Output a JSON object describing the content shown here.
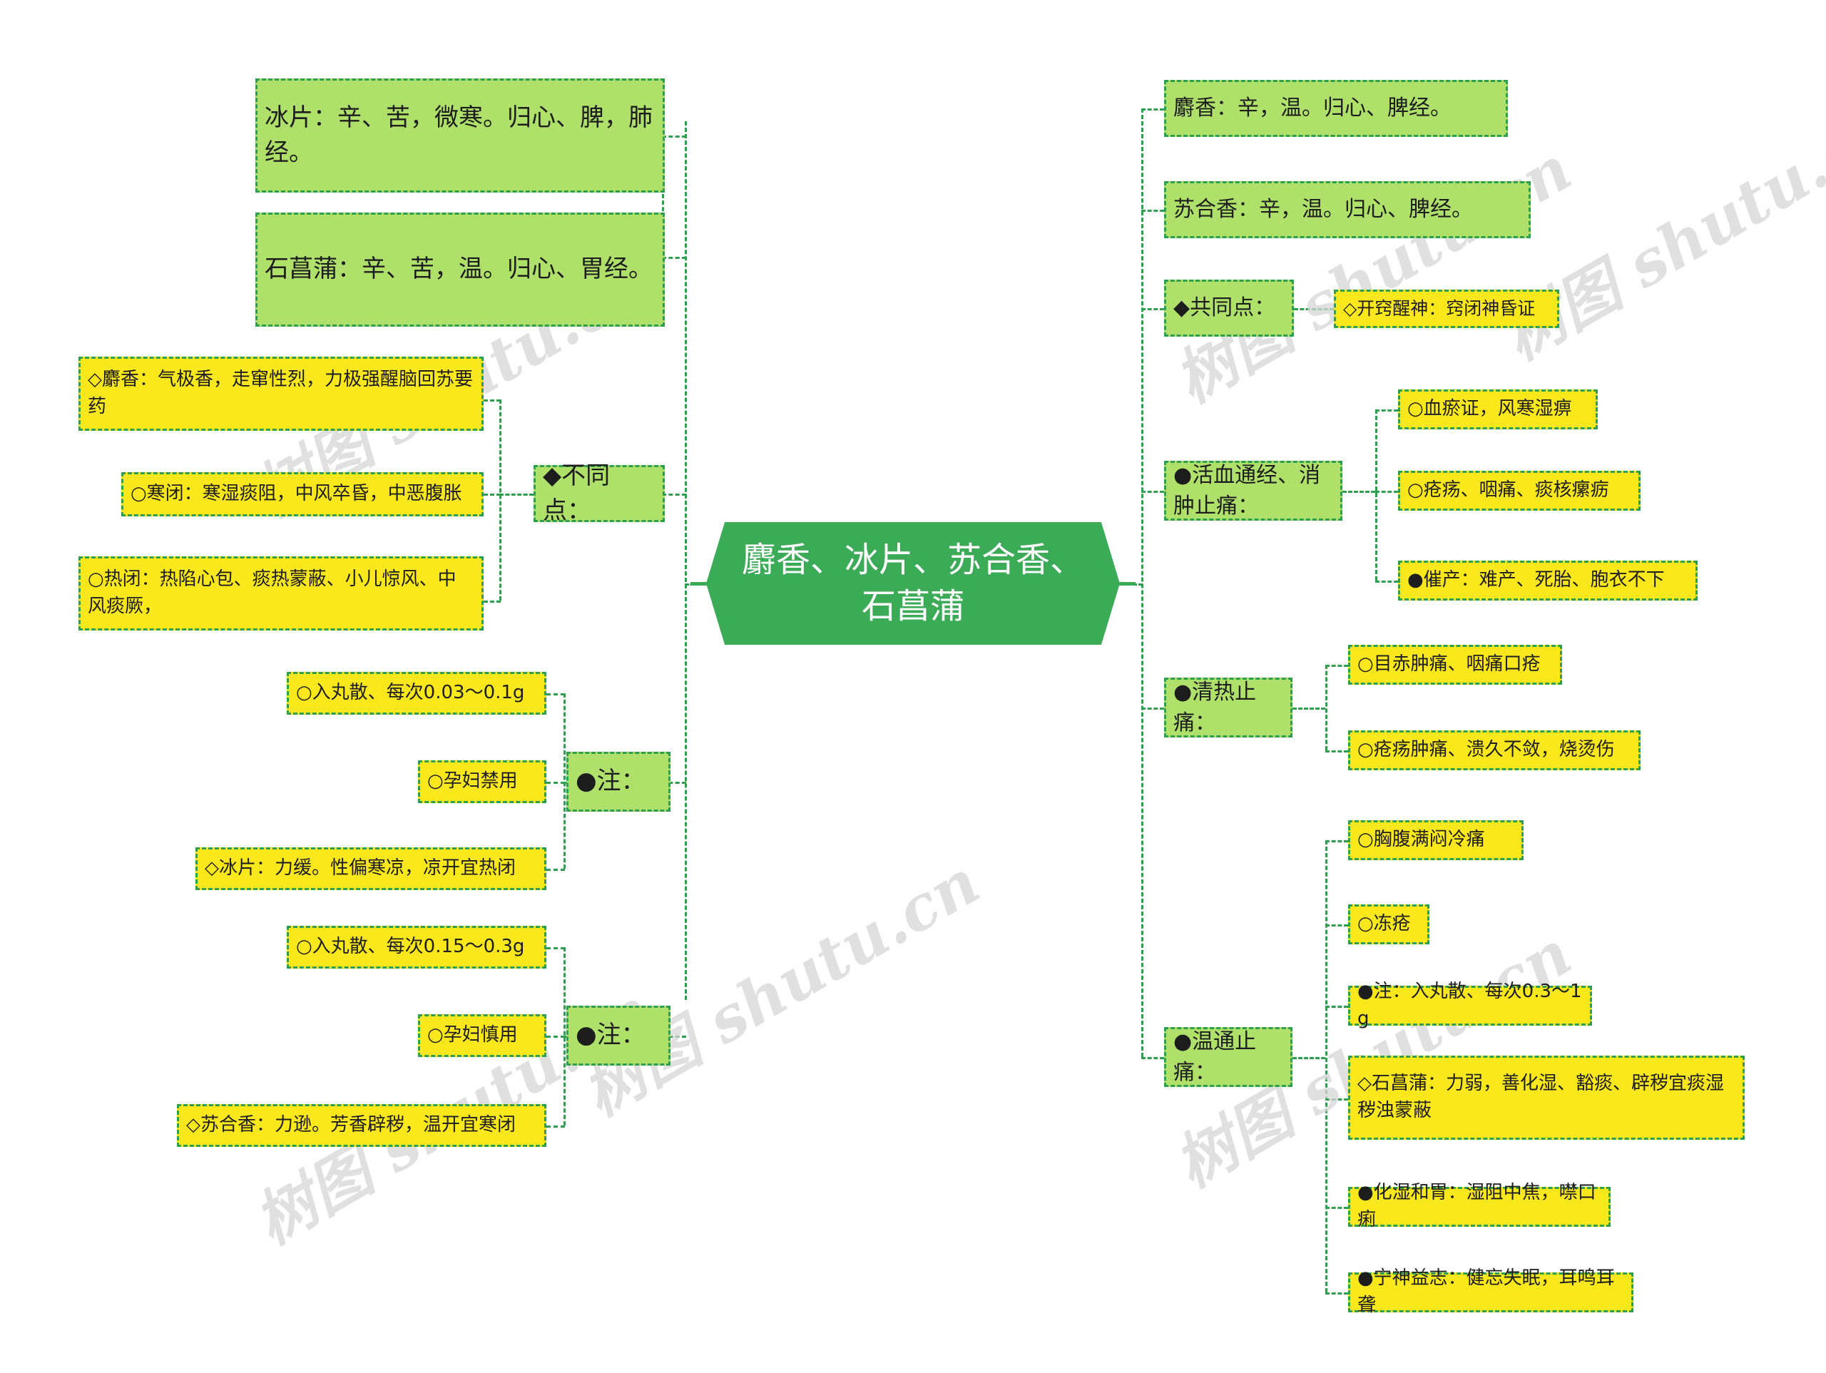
{
  "diagram": {
    "title": "麝香、冰片、苏合香、石菖蒲",
    "watermark": "树图 shutu.cn",
    "colors": {
      "root_fill": "#3cab57",
      "branch_fill": "#aee06a",
      "leaf_fill": "#fbe81c",
      "border": "#2e9e4f",
      "background": "#ffffff"
    }
  },
  "root": {
    "label": "麝香、冰片、苏合香、石菖蒲"
  },
  "left": {
    "properties": [
      {
        "label": "冰片：辛、苦，微寒。归心、脾，肺经。"
      },
      {
        "label": "石菖蒲：辛、苦，温。归心、胃经。"
      }
    ],
    "differences": {
      "label": "◆不同点：",
      "children": [
        {
          "label": "◇麝香：气极香，走窜性烈，力极强醒脑回苏要药"
        },
        {
          "label": "○寒闭：寒湿痰阻，中风卒昏，中恶腹胀"
        },
        {
          "label": "○热闭：热陷心包、痰热蒙蔽、小儿惊风、中风痰厥，"
        }
      ]
    },
    "note_groups": [
      {
        "label": "●注：",
        "children": [
          {
            "label": "○入丸散、每次0.03～0.1g"
          },
          {
            "label": "○孕妇禁用"
          }
        ],
        "sibling": {
          "label": "◇冰片：力缓。性偏寒凉，凉开宜热闭"
        }
      },
      {
        "label": "●注：",
        "children": [
          {
            "label": "○入丸散、每次0.15～0.3g"
          },
          {
            "label": "○孕妇慎用"
          }
        ],
        "sibling": {
          "label": "◇苏合香：力逊。芳香辟秽，温开宜寒闭"
        }
      }
    ]
  },
  "right": {
    "properties": [
      {
        "label": "麝香：辛，温。归心、脾经。"
      },
      {
        "label": "苏合香：辛，温。归心、脾经。"
      }
    ],
    "branches": [
      {
        "label": "◆共同点：",
        "children": [
          {
            "label": "◇开窍醒神：窍闭神昏证"
          }
        ]
      },
      {
        "label": "●活血通经、消肿止痛：",
        "children": [
          {
            "label": "○血瘀证，风寒湿痹"
          },
          {
            "label": "○疮疡、咽痛、痰核瘰疬"
          },
          {
            "label": "●催产：难产、死胎、胞衣不下"
          }
        ]
      },
      {
        "label": "●清热止痛：",
        "children": [
          {
            "label": "○目赤肿痛、咽痛口疮"
          },
          {
            "label": "○疮疡肿痛、溃久不敛，烧烫伤"
          }
        ]
      },
      {
        "label": "●温通止痛：",
        "children": [
          {
            "label": "○胸腹满闷冷痛"
          },
          {
            "label": "○冻疮"
          },
          {
            "label": "●注：入丸散、每次0.3～1g"
          },
          {
            "label": "◇石菖蒲：力弱，善化湿、豁痰、辟秽宜痰湿秽浊蒙蔽"
          },
          {
            "label": "●化湿和胃：湿阻中焦，噤口痢"
          },
          {
            "label": "●宁神益志：健忘失眠，耳鸣耳聋"
          }
        ]
      }
    ]
  }
}
